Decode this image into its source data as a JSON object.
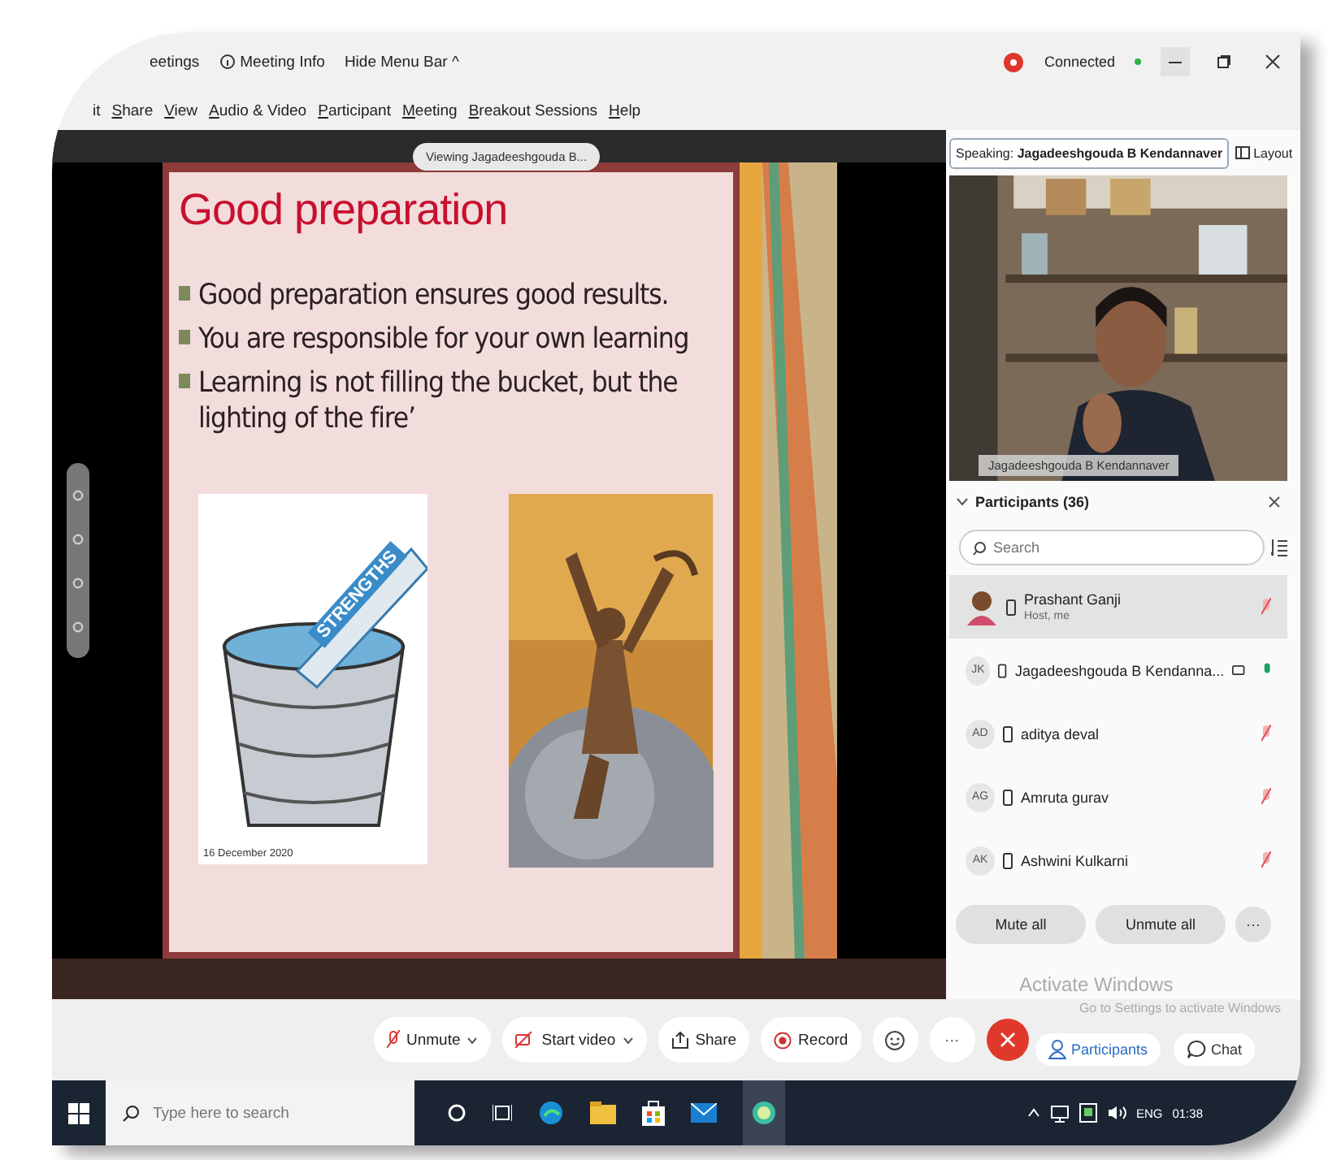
{
  "title_bar": {
    "items": [
      "eetings",
      "Meeting Info",
      "Hide Menu Bar ^"
    ],
    "status": "Connected"
  },
  "menu_bar": [
    "it",
    "Share",
    "View",
    "Audio & Video",
    "Participant",
    "Meeting",
    "Breakout Sessions",
    "Help"
  ],
  "stage": {
    "viewing": "Viewing Jagadeeshgouda B...",
    "slide": {
      "title": "Good preparation",
      "bullets": [
        "Good preparation ensures good results.",
        "You are responsible for your own learning",
        " Learning is not filling the bucket, but the lighting of the fire’"
      ],
      "clipart_label": "STRENGTHS",
      "date": "16 December 2020"
    }
  },
  "panel": {
    "speaking_label": "Speaking:",
    "speaking_name": "Jagadeeshgouda B Kendannaver",
    "layout": "Layout",
    "video_caption": "Jagadeeshgouda B Kendannaver",
    "participants_title": "Participants (36)",
    "search": {
      "placeholder": "Search"
    },
    "participants": [
      {
        "name": "Prashant Ganji",
        "subtitle": "Host, me",
        "video": false,
        "muted": true,
        "selected": true
      },
      {
        "kind": "initials",
        "initials": "JK",
        "name": "Jagadeeshgouda B Kendanna...",
        "video": true,
        "muted": false,
        "selected": false
      },
      {
        "kind": "initials",
        "initials": "AD",
        "name": "aditya deval",
        "video": false,
        "muted": true,
        "selected": false
      },
      {
        "kind": "initials",
        "initials": "AG",
        "name": "Amruta gurav",
        "video": false,
        "muted": true,
        "selected": false
      },
      {
        "kind": "initials",
        "initials": "AK",
        "name": "Ashwini Kulkarni",
        "video": false,
        "muted": true,
        "selected": false
      }
    ],
    "mute_all": "Mute all",
    "unmute_all": "Unmute all",
    "more": "···"
  },
  "activation": {
    "title": "Activate Windows",
    "hint": "Go to Settings to activate Windows"
  },
  "toolbar": {
    "buttons": [
      {
        "kind": "mic",
        "label": "Unmute",
        "dropdown": true
      },
      {
        "kind": "video",
        "label": "Start video",
        "dropdown": true
      },
      {
        "kind": "share",
        "label": "Share",
        "dropdown": false
      },
      {
        "kind": "record",
        "label": "Record",
        "dropdown": false
      }
    ],
    "more": "···",
    "side": [
      {
        "kind": "participants",
        "label": "Participants",
        "selected": true
      },
      {
        "kind": "chat",
        "label": "Chat",
        "selected": false
      }
    ]
  },
  "taskbar": {
    "search": {
      "placeholder": "Type here to search"
    },
    "language": "ENG",
    "time": "01:38"
  }
}
